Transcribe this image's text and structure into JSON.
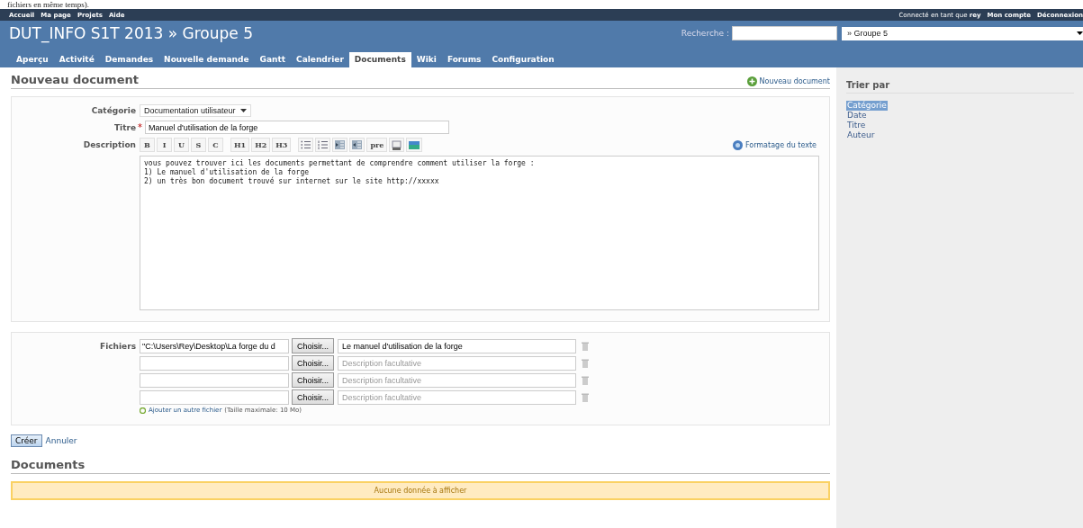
{
  "caption": "fichiers en même temps).",
  "top_menu": {
    "links": [
      "Accueil",
      "Ma page",
      "Projets",
      "Aide"
    ],
    "logged_in": "Connecté en tant que **rey**",
    "account_links": [
      "Mon compte",
      "Déconnexion"
    ]
  },
  "header": {
    "title": "DUT_INFO S1T 2013 » Groupe 5",
    "search_label": "Recherche :",
    "project_select": "» Groupe 5"
  },
  "tabs": [
    {
      "label": "Aperçu",
      "selected": false
    },
    {
      "label": "Activité",
      "selected": false
    },
    {
      "label": "Demandes",
      "selected": false
    },
    {
      "label": "Nouvelle demande",
      "selected": false
    },
    {
      "label": "Gantt",
      "selected": false
    },
    {
      "label": "Calendrier",
      "selected": false
    },
    {
      "label": "Documents",
      "selected": true
    },
    {
      "label": "Wiki",
      "selected": false
    },
    {
      "label": "Forums",
      "selected": false
    },
    {
      "label": "Configuration",
      "selected": false
    }
  ],
  "form": {
    "heading": "Nouveau document",
    "new_link": "Nouveau document",
    "category_label": "Catégorie",
    "category": "Documentation utilisateur",
    "title_label": "Titre",
    "required_mark": "*",
    "title": "Manuel d'utilisation de la forge",
    "description_label": "Description",
    "toolbar": [
      {
        "kind": "text",
        "label": "B"
      },
      {
        "kind": "text",
        "label": "I"
      },
      {
        "kind": "text",
        "label": "U"
      },
      {
        "kind": "text",
        "label": "S"
      },
      {
        "kind": "text",
        "label": "C"
      },
      {
        "kind": "text",
        "label": "H1"
      },
      {
        "kind": "text",
        "label": "H2"
      },
      {
        "kind": "text",
        "label": "H3"
      },
      {
        "kind": "bullets"
      },
      {
        "kind": "numbers"
      },
      {
        "kind": "indent"
      },
      {
        "kind": "outdent"
      },
      {
        "kind": "text",
        "label": "pre"
      },
      {
        "kind": "link"
      },
      {
        "kind": "image"
      }
    ],
    "formatting_link": "Formatage du texte",
    "description": "vous pouvez trouver ici les documents permettant de comprendre comment utiliser la forge :\n1) Le manuel d'utilisation de la forge\n2) un très bon document trouvé sur internet sur le site http://xxxxx",
    "files_label": "Fichiers",
    "files": [
      {
        "path": "\"C:\\Users\\Rey\\Desktop\\La forge du d",
        "button": "Choisir...",
        "description": "Le manuel d'utilisation de la forge"
      },
      {
        "button": "Choisir...",
        "placeholder": "Description facultative"
      },
      {
        "button": "Choisir...",
        "placeholder": "Description facultative"
      },
      {
        "button": "Choisir...",
        "placeholder": "Description facultative"
      }
    ],
    "add_file": "Ajouter un autre fichier",
    "max_size": "(Taille maximale: 10 Mo)",
    "submit": "Créer",
    "cancel": "Annuler"
  },
  "documents": {
    "heading": "Documents",
    "empty": "Aucune donnée à afficher"
  },
  "sidebar": {
    "heading": "Trier par",
    "items": [
      {
        "label": "Catégorie",
        "selected": true
      },
      {
        "label": "Date",
        "selected": false
      },
      {
        "label": "Titre",
        "selected": false
      },
      {
        "label": "Auteur",
        "selected": false
      }
    ]
  }
}
